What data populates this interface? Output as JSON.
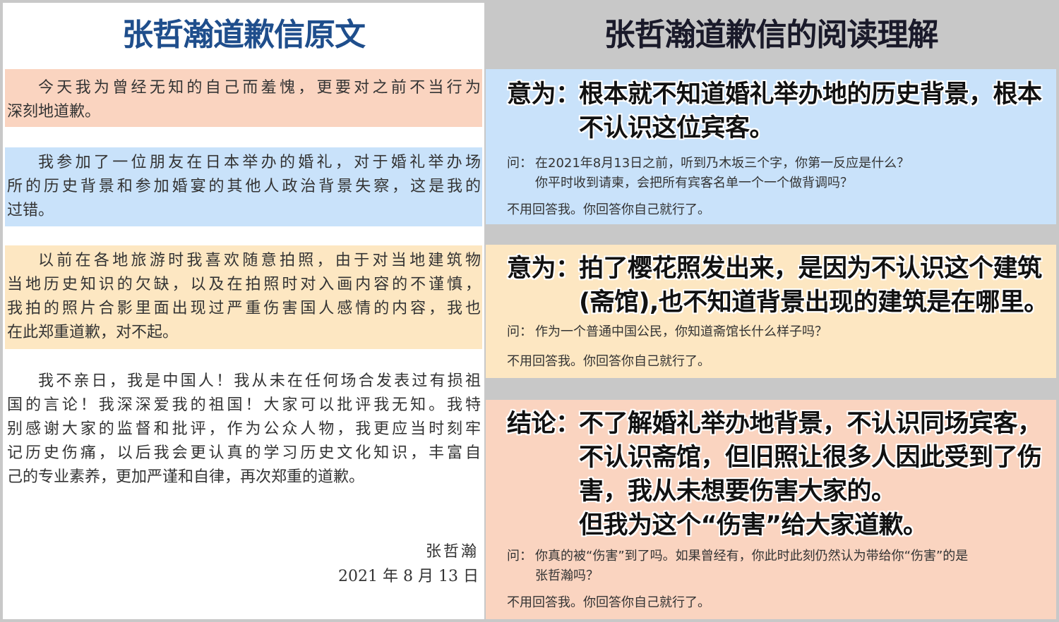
{
  "left": {
    "title": "张哲瀚道歉信原文",
    "paragraphs": [
      [
        "今天我为曾经无知的自己而羞愧，更要对之前不当行为",
        "深刻地道歉。"
      ],
      [
        "我参加了一位朋友在日本举办的婚礼，对于婚礼举办场",
        "所的历史背景和参加婚宴的其他人政治背景失察，这是我的",
        "过错。"
      ],
      [
        "以前在各地旅游时我喜欢随意拍照，由于对当地建筑物",
        "当地历史知识的欠缺，以及在拍照时对入画内容的不谨慎，",
        "我拍的照片合影里面出现过严重伤害国人感情的内容，我也",
        "在此郑重道歉，对不起。"
      ],
      [
        "我不亲日，我是中国人！我从未在任何场合发表过有损祖",
        "国的言论！我深深爱我的祖国！大家可以批评我无知。我特",
        "别感谢大家的监督和批评，作为公众人物，我更应当时刻牢",
        "记历史伤痛，以后我会更认真的学习历史文化知识，丰富自",
        "己的专业素养，更加严谨和自律，再次郑重的道歉。"
      ]
    ],
    "signature_name": "张哲瀚",
    "signature_date": "2021 年 8 月 13 日"
  },
  "right": {
    "title": "张哲瀚道歉信的阅读理解",
    "boxes": [
      {
        "label": "意为：",
        "heading_lines": [
          "根本就不知道婚礼举办地的历史背景，根本",
          "不认识这位宾客。"
        ],
        "q_label": "问：",
        "question_lines": [
          "在2021年8月13日之前，听到乃木坂三个字，你第一反应是什么？",
          "你平时收到请柬，会把所有宾客名单一个一个做背调吗？"
        ],
        "no_reply": "不用回答我。你回答你自己就行了。"
      },
      {
        "label": "意为：",
        "heading_lines": [
          "拍了樱花照发出来，是因为不认识这个建筑",
          "(斋馆),也不知道背景出现的建筑是在哪里。"
        ],
        "q_label": "问：",
        "question_lines": [
          "作为一个普通中国公民，你知道斋馆长什么样子吗？"
        ],
        "no_reply": "不用回答我。你回答你自己就行了。"
      },
      {
        "label": "结论：",
        "heading_lines": [
          "不了解婚礼举办地背景，不认识同场宾客，",
          "不认识斋馆，但旧照让很多人因此受到了伤",
          "害，我从未想要伤害大家的。",
          "但我为这个“伤害”给大家道歉。"
        ],
        "q_label": "问：",
        "question_lines": [
          "你真的被“伤害”到了吗。如果曾经有，你此时此刻仍然认为带给你“伤害”的是",
          "张哲瀚吗？"
        ],
        "no_reply": "不用回答我。你回答你自己就行了。"
      }
    ]
  }
}
